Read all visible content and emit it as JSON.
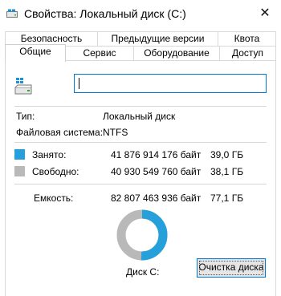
{
  "window": {
    "title": "Свойства: Локальный диск (C:)",
    "close_glyph": "✕",
    "icon": "drive-app-icon"
  },
  "tabs_row1": [
    {
      "label": "Безопасность"
    },
    {
      "label": "Предыдущие версии"
    },
    {
      "label": "Квота"
    }
  ],
  "tabs_row2": [
    {
      "label": "Общие",
      "active": true
    },
    {
      "label": "Сервис"
    },
    {
      "label": "Оборудование"
    },
    {
      "label": "Доступ"
    }
  ],
  "general": {
    "name_value": "",
    "type_label": "Тип:",
    "type_value": "Локальный диск",
    "fs_label": "Файловая система:",
    "fs_value": "NTFS",
    "used": {
      "label": "Занято:",
      "bytes": "41 876 914 176 байт",
      "size": "39,0 ГБ",
      "color": "#26a0da"
    },
    "free": {
      "label": "Свободно:",
      "bytes": "40 930 549 760 байт",
      "size": "38,1 ГБ",
      "color": "#b9b9b9"
    },
    "capacity": {
      "label": "Емкость:",
      "bytes": "82 807 463 936 байт",
      "size": "77,1 ГБ"
    },
    "used_fraction": 0.5057,
    "disk_label": "Диск C:",
    "cleanup_button": "Очистка диска"
  }
}
